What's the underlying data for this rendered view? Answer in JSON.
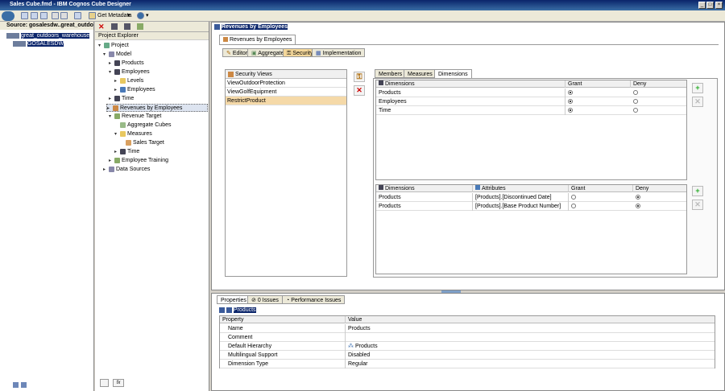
{
  "window": {
    "title": "Sales Cube.fmd - IBM Cognos Cube Designer"
  },
  "toolbar": {
    "get_metadata": "Get Metadata"
  },
  "source": {
    "header": "Source: gosalesdw..great_outdoors_wa",
    "items": [
      {
        "label": "great_outdoors_warehouse"
      },
      {
        "label": "GOSALESDW"
      }
    ]
  },
  "explorer": {
    "title": "Project Explorer",
    "tree": [
      {
        "label": "Project"
      },
      {
        "label": "Model"
      },
      {
        "label": "Products"
      },
      {
        "label": "Employees"
      },
      {
        "label": "Levels"
      },
      {
        "label": "Employees"
      },
      {
        "label": "Time"
      },
      {
        "label": "Revenues by Employees"
      },
      {
        "label": "Revenue Target"
      },
      {
        "label": "Aggregate Cubes"
      },
      {
        "label": "Measures"
      },
      {
        "label": "Sales Target"
      },
      {
        "label": "Time"
      },
      {
        "label": "Employee Training"
      },
      {
        "label": "Data Sources"
      }
    ]
  },
  "editor": {
    "heading": "Revenues by Employees",
    "object_tab": "Revenues by Employees",
    "subtabs": [
      {
        "label": "Editor"
      },
      {
        "label": "Aggregates"
      },
      {
        "label": "Security"
      },
      {
        "label": "Implementation"
      }
    ],
    "security_views": {
      "header": "Security Views",
      "items": [
        "ViewOutdoorProtection",
        "ViewGolfEquipment",
        "RestrictProduct"
      ]
    },
    "detail_tabs": [
      {
        "label": "Members"
      },
      {
        "label": "Measures"
      },
      {
        "label": "Dimensions"
      }
    ],
    "dim_grid": {
      "headers": {
        "dimensions": "Dimensions",
        "grant": "Grant",
        "deny": "Deny"
      },
      "rows": [
        {
          "dimension": "Products",
          "grant": true
        },
        {
          "dimension": "Employees",
          "grant": true
        },
        {
          "dimension": "Time",
          "grant": true
        }
      ]
    },
    "attr_grid": {
      "headers": {
        "dimensions": "Dimensions",
        "attributes": "Attributes",
        "grant": "Grant",
        "deny": "Deny"
      },
      "rows": [
        {
          "dimension": "Products",
          "attribute": "[Products].[Discontinued Date]",
          "grant": false
        },
        {
          "dimension": "Products",
          "attribute": "[Products].[Base Product Number]",
          "grant": false
        }
      ]
    }
  },
  "properties": {
    "tabs": [
      {
        "label": "Properties"
      },
      {
        "label": "0 Issues"
      },
      {
        "label": "Performance Issues"
      }
    ],
    "object_name": "Products",
    "headers": {
      "property": "Property",
      "value": "Value"
    },
    "rows": [
      {
        "property": "Name",
        "value": "Products"
      },
      {
        "property": "Comment",
        "value": ""
      },
      {
        "property": "Default Hierarchy",
        "value": "Products"
      },
      {
        "property": "Multilingual Support",
        "value": "Disabled"
      },
      {
        "property": "Dimension Type",
        "value": "Regular"
      }
    ]
  },
  "colors": {
    "selection": "#0a246a",
    "highlight_row": "#f5d9a8",
    "title_bar": "#0a246a"
  }
}
